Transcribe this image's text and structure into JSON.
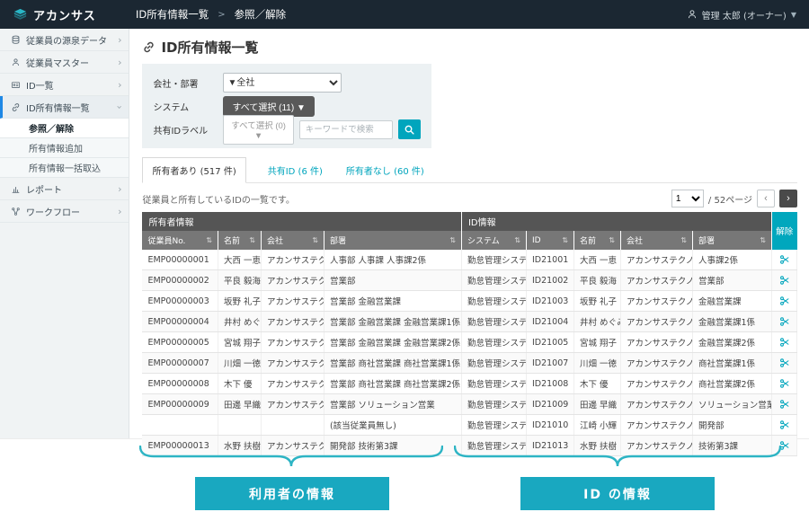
{
  "header": {
    "logo_text": "アカンサス",
    "breadcrumb": {
      "first": "ID所有情報一覧",
      "sep": ">",
      "second": "参照／解除"
    },
    "user": "管理 太郎 (オーナー)",
    "user_caret": "▼"
  },
  "sidebar": {
    "items": [
      {
        "label": "従業員の源泉データ"
      },
      {
        "label": "従業員マスター"
      },
      {
        "label": "ID一覧"
      },
      {
        "label": "ID所有情報一覧"
      },
      {
        "label": "レポート"
      },
      {
        "label": "ワークフロー"
      }
    ],
    "subitems": [
      {
        "label": "参照／解除"
      },
      {
        "label": "所有情報追加"
      },
      {
        "label": "所有情報一括取込"
      }
    ],
    "chevron": "›"
  },
  "main": {
    "title": "ID所有情報一覧",
    "filters": {
      "company_label": "会社・部署",
      "company_value": "▼全社",
      "system_label": "システム",
      "system_value": "すべて選択 (11) ▼",
      "shared_label": "共有IDラベル",
      "shared_value": "すべて選択 (0) ▼",
      "keyword_placeholder": "キーワードで検索"
    },
    "tabs": [
      {
        "label": "所有者あり (517 件)"
      },
      {
        "label": "共有ID (6 件)"
      },
      {
        "label": "所有者なし (60 件)"
      }
    ],
    "description": "従業員と所有しているIDの一覧です。",
    "pagination": {
      "page": "1",
      "total": "/ 52ページ",
      "prev": "‹",
      "next": "›"
    }
  },
  "table": {
    "group_headers": {
      "owner": "所有者情報",
      "id": "ID情報",
      "release": "解除"
    },
    "sort_glyph": "⇅",
    "columns": [
      "従業員No.",
      "名前",
      "会社",
      "部署",
      "システム",
      "ID",
      "名前",
      "会社",
      "部署"
    ],
    "rows": [
      {
        "emp_no": "EMP00000001",
        "name": "大西 一恵",
        "company": "アカンサステクノ",
        "dept": "人事部 人事課 人事課2係",
        "system": "勤怠管理システム",
        "id": "ID21001",
        "id_name": "大西 一恵",
        "id_company": "アカンサステクノ",
        "id_dept": "人事課2係"
      },
      {
        "emp_no": "EMP00000002",
        "name": "平良 毅海",
        "company": "アカンサステクノ",
        "dept": "営業部",
        "system": "勤怠管理システム",
        "id": "ID21002",
        "id_name": "平良 毅海",
        "id_company": "アカンサステクノ",
        "id_dept": "営業部"
      },
      {
        "emp_no": "EMP00000003",
        "name": "坂野 礼子",
        "company": "アカンサステクノ",
        "dept": "営業部 金融営業課",
        "system": "勤怠管理システム",
        "id": "ID21003",
        "id_name": "坂野 礼子",
        "id_company": "アカンサステクノ",
        "id_dept": "金融営業課"
      },
      {
        "emp_no": "EMP00000004",
        "name": "井村 めぐみ",
        "company": "アカンサステクノ",
        "dept": "営業部 金融営業課 金融営業課1係",
        "system": "勤怠管理システム",
        "id": "ID21004",
        "id_name": "井村 めぐみ",
        "id_company": "アカンサステクノ",
        "id_dept": "金融営業課1係"
      },
      {
        "emp_no": "EMP00000005",
        "name": "宮城 翔子",
        "company": "アカンサステクノ",
        "dept": "営業部 金融営業課 金融営業課2係",
        "system": "勤怠管理システム",
        "id": "ID21005",
        "id_name": "宮城 翔子",
        "id_company": "アカンサステクノ",
        "id_dept": "金融営業課2係"
      },
      {
        "emp_no": "EMP00000007",
        "name": "川畑 一徳",
        "company": "アカンサステクノ",
        "dept": "営業部 商社営業課 商社営業課1係",
        "system": "勤怠管理システム",
        "id": "ID21007",
        "id_name": "川畑 一徳",
        "id_company": "アカンサステクノ",
        "id_dept": "商社営業課1係"
      },
      {
        "emp_no": "EMP00000008",
        "name": "木下 優",
        "company": "アカンサステクノ",
        "dept": "営業部 商社営業課 商社営業課2係",
        "system": "勤怠管理システム",
        "id": "ID21008",
        "id_name": "木下 優",
        "id_company": "アカンサステクノ",
        "id_dept": "商社営業課2係"
      },
      {
        "emp_no": "EMP00000009",
        "name": "田邊 早織",
        "company": "アカンサステクノ",
        "dept": "営業部 ソリューション営業",
        "system": "勤怠管理システム",
        "id": "ID21009",
        "id_name": "田邊 早織",
        "id_company": "アカンサステクノ",
        "id_dept": "ソリューション営業"
      },
      {
        "emp_no": "",
        "name": "",
        "company": "",
        "dept": "(該当従業員無し)",
        "note": true,
        "system": "勤怠管理システム",
        "id": "ID21010",
        "id_name": "江崎 小輝",
        "id_company": "アカンサステクノ",
        "id_dept": "開発部"
      },
      {
        "emp_no": "EMP00000013",
        "name": "水野 扶樹",
        "company": "アカンサステクノ",
        "dept": "開発部 技術第3課",
        "system": "勤怠管理システム",
        "id": "ID21013",
        "id_name": "水野 扶樹",
        "id_company": "アカンサステクノ",
        "id_dept": "技術第3課"
      }
    ]
  },
  "annotations": {
    "left_label": "利用者の情報",
    "right_label": "ID の情報"
  },
  "colors": {
    "accent": "#00a5bd",
    "header_bg": "#1b2732",
    "annotation_teal": "#19a8c0"
  }
}
